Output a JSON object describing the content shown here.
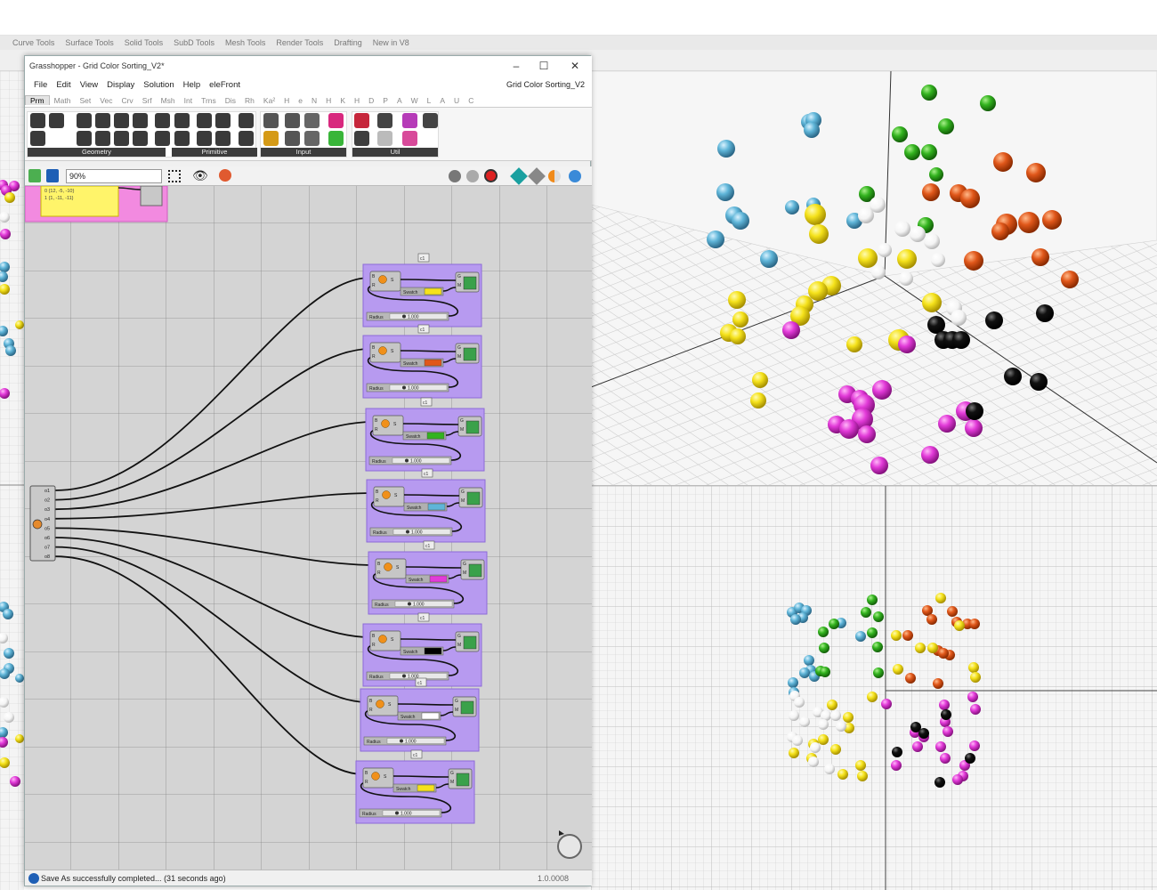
{
  "rhino": {
    "tabs": [
      "Curve Tools",
      "Surface Tools",
      "Solid Tools",
      "SubD Tools",
      "Mesh Tools",
      "Render Tools",
      "Drafting",
      "New in V8"
    ]
  },
  "gh": {
    "title": "Grasshopper - Grid Color Sorting_V2*",
    "doc_name": "Grid Color Sorting_V2",
    "menu": [
      "File",
      "Edit",
      "View",
      "Display",
      "Solution",
      "Help",
      "eleFront"
    ],
    "categories": [
      "Prm",
      "Math",
      "Set",
      "Vec",
      "Crv",
      "Srf",
      "Msh",
      "Int",
      "Trns",
      "Dis",
      "Rh",
      "Ka²",
      "H",
      "e",
      "N",
      "H",
      "K",
      "H",
      "D",
      "P",
      "A",
      "W",
      "L",
      "A",
      "U",
      "C"
    ],
    "panels": [
      "Geometry",
      "Primitive",
      "Input",
      "Util"
    ],
    "zoom": "90%",
    "status": "Save As successfully completed... (31 seconds ago)",
    "version": "1.0.0008",
    "panel_lines": [
      "0 {12, -5, -10}",
      "1 {1, -11, -11}"
    ],
    "outputs": [
      "o1",
      "o2",
      "o3",
      "o4",
      "o5",
      "o6",
      "o7",
      "o8"
    ],
    "group_labels": {
      "b": "B",
      "r": "R",
      "s": "S",
      "g": "G",
      "m": "M",
      "swatch": "Swatch",
      "radius": "Radius",
      "slider_value": "1.000",
      "relay": "c1"
    },
    "groups": [
      {
        "swatch_color": "#f5e21b"
      },
      {
        "swatch_color": "#e0571a"
      },
      {
        "swatch_color": "#33b31f"
      },
      {
        "swatch_color": "#5fb5d8"
      },
      {
        "swatch_color": "#e23ad8"
      },
      {
        "swatch_color": "#000000"
      },
      {
        "swatch_color": "#ffffff"
      },
      {
        "swatch_color": "#f5e21b"
      }
    ]
  },
  "colors": {
    "group_fill": "#b79af0",
    "group_border": "#8c6ad8",
    "panel_yellow": "#fff46a",
    "panel_pink": "#f28ae0",
    "canvas": "#d4d4d4",
    "sphere_yellow": "#f5e21b",
    "sphere_orange": "#e0571a",
    "sphere_green": "#33b31f",
    "sphere_blue": "#5fb5d8",
    "sphere_magenta": "#e23ad8",
    "sphere_black": "#111111",
    "sphere_white": "#ffffff"
  }
}
